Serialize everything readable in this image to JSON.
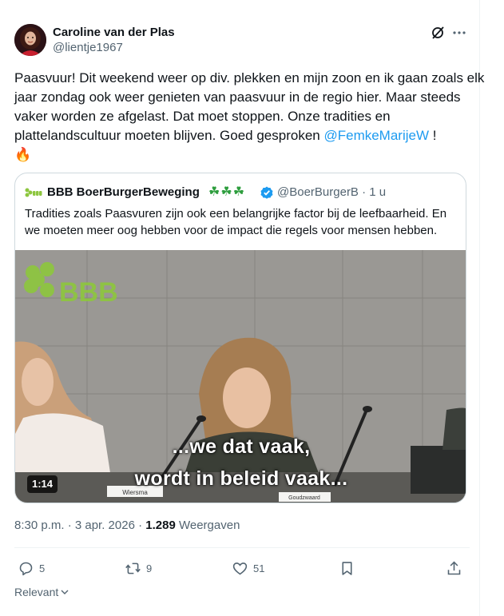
{
  "author": {
    "name": "Caroline van der Plas",
    "handle": "@lientje1967"
  },
  "tweet": {
    "text_main": "Paasvuur! Dit weekend weer op div. plekken en mijn zoon en ik gaan zoals elk jaar zondag ook weer genieten van paasvuur in de regio hier. Maar steeds vaker worden ze afgelast. Dat moet stoppen. Onze tradities en plattelandscultuur moeten blijven. Goed gesproken ",
    "mention": "@FemkeMarijeW",
    "text_end": " !",
    "emoji": "🔥"
  },
  "quote": {
    "name": "BBB BoerBurgerBeweging",
    "clovers": "☘☘☘",
    "handle": "@BoerBurgerB · 1 u",
    "text": "Tradities zoals Paasvuren zijn ook een belangrijke factor bij de leefbaarheid. En we moeten meer oog hebben voor de impact die regels voor mensen hebben.",
    "video": {
      "logo_text": "BBB",
      "caption_line1": "...we dat vaak,",
      "caption_line2": "wordt in beleid vaak...",
      "duration": "1:14",
      "nameplate_left": "Wiersma",
      "nameplate_right": "Goudzwaard"
    }
  },
  "meta": {
    "time_date": "8:30 p.m. · 3 apr. 2026 · ",
    "views_count": "1.289",
    "views_label": " Weergaven"
  },
  "actions": {
    "replies": "5",
    "reposts": "9",
    "likes": "51"
  },
  "sort": {
    "label": "Relevant"
  },
  "colors": {
    "accent": "#1d9bf0",
    "secondary_text": "#536471",
    "bbb_green": "#8dc63f"
  },
  "icons": [
    "grok-icon",
    "more-icon",
    "verified-icon",
    "reply-icon",
    "repost-icon",
    "like-icon",
    "bookmark-icon",
    "share-icon",
    "chevron-down-icon",
    "fire-emoji"
  ]
}
